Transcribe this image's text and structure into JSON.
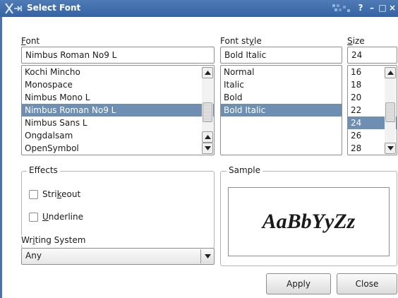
{
  "window": {
    "title": "Select Font",
    "icons": {
      "app": "x-app-icon",
      "help": "?",
      "minimize": "–",
      "maximize": "□",
      "close": "×"
    }
  },
  "font": {
    "label_mnemonic": "F",
    "label_rest": "ont",
    "value": "Nimbus Roman No9 L",
    "items": [
      "Kochi Mincho",
      "Monospace",
      "Nimbus Mono L",
      "Nimbus Roman No9 L",
      "Nimbus Sans L",
      "Ongdalsam",
      "OpenSymbol"
    ],
    "selected_index": 3
  },
  "style": {
    "label_pre": "Font st",
    "label_mnemonic": "y",
    "label_post": "le",
    "value": "Bold Italic",
    "items": [
      "Normal",
      "Italic",
      "Bold",
      "Bold Italic"
    ],
    "selected_index": 3
  },
  "size": {
    "label_mnemonic": "S",
    "label_rest": "ize",
    "value": "24",
    "items": [
      "16",
      "18",
      "20",
      "22",
      "24",
      "26",
      "28"
    ],
    "selected_index": 4
  },
  "effects": {
    "title": "Effects",
    "strikeout_pre": "Stri",
    "strikeout_mnemonic": "k",
    "strikeout_post": "eout",
    "underline_mnemonic": "U",
    "underline_rest": "nderline"
  },
  "writing_system": {
    "label_pre": "Wr",
    "label_mnemonic": "i",
    "label_post": "ting System",
    "value": "Any"
  },
  "sample": {
    "title": "Sample",
    "text": "AaBbYyZz"
  },
  "buttons": {
    "apply": "Apply",
    "close": "Close"
  }
}
